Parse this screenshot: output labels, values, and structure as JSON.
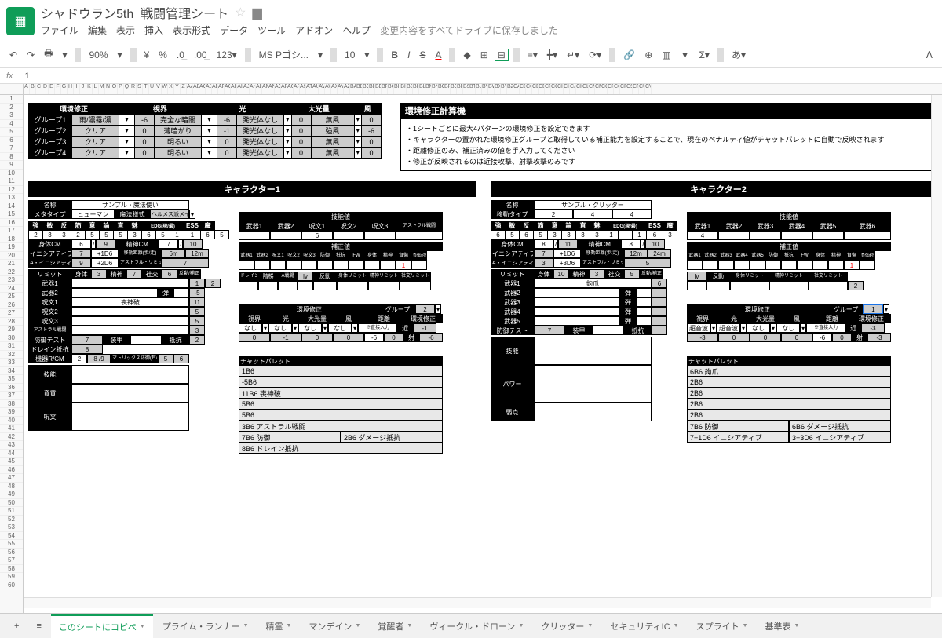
{
  "doc": {
    "title": "シャドウラン5th_戦闘管理シート",
    "save_msg": "変更内容をすべてドライブに保存しました"
  },
  "menu": [
    "ファイル",
    "編集",
    "表示",
    "挿入",
    "表示形式",
    "データ",
    "ツール",
    "アドオン",
    "ヘルプ"
  ],
  "toolbar": {
    "zoom": "90%",
    "currency": "¥",
    "font": "MS Pゴシ...",
    "size": "10"
  },
  "formula": "1",
  "env": {
    "title": "環境修正",
    "headers": [
      "視界",
      "光",
      "大光量",
      "風"
    ],
    "rows": [
      {
        "grp": "グループ1",
        "vis": "雨/濃霧/濃",
        "vis_v": "-6",
        "light": "完全な暗闇",
        "light_v": "-6",
        "glare": "発光体なし",
        "glare_v": "0",
        "wind": "無風",
        "wind_v": "0"
      },
      {
        "grp": "グループ2",
        "vis": "クリア",
        "vis_v": "0",
        "light": "薄暗がり",
        "light_v": "-1",
        "glare": "発光体なし",
        "glare_v": "0",
        "wind": "強風",
        "wind_v": "-6"
      },
      {
        "grp": "グループ3",
        "vis": "クリア",
        "vis_v": "0",
        "light": "明るい",
        "light_v": "0",
        "glare": "発光体なし",
        "glare_v": "0",
        "wind": "無風",
        "wind_v": "0"
      },
      {
        "grp": "グループ4",
        "vis": "クリア",
        "vis_v": "0",
        "light": "明るい",
        "light_v": "0",
        "glare": "発光体なし",
        "glare_v": "0",
        "wind": "無風",
        "wind_v": "0"
      }
    ]
  },
  "calc": {
    "title": "環境修正計算機",
    "lines": [
      "・1シートごとに最大4パターンの環境修正を設定できます",
      "・キャラクターの置かれた環境修正グループと取得している補正能力を設定することで、現在のペナルティ値がチャットパレットに自動で反映されます",
      "・距離修正のみ、補正済みの値を手入力してください",
      "・修正が反映されるのは近接攻撃、射撃攻撃のみです"
    ]
  },
  "char1": {
    "title": "キャラクター1",
    "name_lbl": "名称",
    "name": "サンプル・魔法使い",
    "meta_lbl": "メタタイプ",
    "meta": "ヒューマン",
    "magic_lbl": "魔法様式",
    "magic": "ヘルメス派メイジ",
    "attrs_hdr": [
      "強",
      "敏",
      "反",
      "筋",
      "意",
      "論",
      "直",
      "魅",
      "EDG(現/最)",
      "ESS",
      "魔"
    ],
    "attrs": [
      "2",
      "3",
      "3",
      "2",
      "5",
      "5",
      "5",
      "3",
      "6",
      "5",
      "1",
      "1",
      "6",
      "5"
    ],
    "body_cm_lbl": "身体CM",
    "body_cm": "6",
    "body_cm_max": "9",
    "mind_cm_lbl": "精神CM",
    "mind_cm": "7",
    "mind_cm_max": "10",
    "init_lbl": "イニシアティブ",
    "init": "7",
    "init_d": "+1D6",
    "move_lbl": "移動距離(歩/走)",
    "move": "6m",
    "run": "12m",
    "ainit_lbl": "A・イニシアティブ",
    "ainit": "9",
    "ainit_d": "+2D6",
    "alim_lbl": "アストラル・リミット",
    "alim": "7",
    "limit_lbl": "リミット",
    "phys_lbl": "身体",
    "phys": "3",
    "mind_lbl": "精神",
    "mind": "7",
    "soc_lbl": "社交",
    "soc": "6",
    "react_lbl": "反動/補正",
    "weapon1_lbl": "武器1",
    "weapon1_r": "1",
    "weapon1_r2": "2",
    "weapon2_lbl": "武器2",
    "weapon2_r": "-5",
    "bullet": "弾",
    "spell1_lbl": "呪文1",
    "spell1": "喪神破",
    "spell1_r": "11",
    "spell2_lbl": "呪文2",
    "spell2_r": "5",
    "spell3_lbl": "呪文3",
    "spell3_r": "5",
    "astral_lbl": "アストラル戦闘",
    "astral_r": "3",
    "def_lbl": "防御テスト",
    "def": "7",
    "armor_lbl": "装甲",
    "resist_lbl": "抵抗",
    "def_r": "2",
    "drain_lbl": "ドレイン抵抗",
    "drain": "8",
    "matrix_lbl": "機器R/CM",
    "matrix": "2",
    "matrix_cm": "8 /9",
    "mxdef_lbl": "マトリックス防御(耳/破)",
    "mxdef": "5",
    "mxdef2": "6",
    "skill_lbl": "技能",
    "quality_lbl": "資質",
    "spells_lbl": "呪文",
    "skill_hdr": "技能値",
    "skills": [
      "武器1",
      "武器2",
      "呪文1",
      "呪文2",
      "呪文3",
      "アストラル戦闘"
    ],
    "skill_val": "6",
    "mod_hdr": "補正値",
    "mod_sub": [
      "武器1",
      "武器2",
      "呪文1",
      "呪文2",
      "呪文3",
      "防御",
      "抵抗",
      "FW",
      "身体",
      "精神",
      "負傷",
      "負傷耐性"
    ],
    "mod_val": "1",
    "drain_sub": "ドレイン",
    "kaitei": "階梯",
    "asen": "A戦闘",
    "lv": "lv",
    "react_sub": "反動",
    "phys_lim_sub": "身体リミット",
    "mind_lim_sub": "精神リミット",
    "soc_lim_sub": "社交リミット",
    "env_mod_hdr": "環境修正",
    "group_lbl": "グループ",
    "group_val": "2",
    "env_hdrs": [
      "視界",
      "光",
      "大光量",
      "風",
      "距離",
      "環境修正"
    ],
    "env_row1": [
      "なし",
      "なし",
      "なし",
      "なし",
      "※直接入力",
      "近",
      "-1"
    ],
    "env_row2": [
      "0",
      "-1",
      "0",
      "0",
      "-6",
      "0",
      "射",
      "-6"
    ],
    "chat_lbl": "チャットパレット",
    "chat": [
      "1B6",
      "-5B6",
      "11B6 喪神破",
      "5B6",
      "5B6",
      "3B6 アストラル戦闘",
      "7B6 防御",
      "2B6 ダメージ抵抗",
      "8B6 ドレイン抵抗"
    ]
  },
  "char2": {
    "title": "キャラクター2",
    "name_lbl": "名称",
    "name": "サンプル・クリッター",
    "move_type_lbl": "移動タイプ",
    "move_type": [
      "2",
      "4",
      "4"
    ],
    "attrs_hdr": [
      "強",
      "敏",
      "反",
      "筋",
      "意",
      "論",
      "直",
      "魅",
      "EDG(現/最)",
      "ESS",
      "魔"
    ],
    "attrs": [
      "6",
      "5",
      "6",
      "5",
      "3",
      "3",
      "3",
      "3",
      "1",
      "1",
      "6",
      "3"
    ],
    "body_cm_lbl": "身体CM",
    "body_cm": "8",
    "body_cm_max": "11",
    "mind_cm_lbl": "精神CM",
    "mind_cm": "8",
    "mind_cm_max": "10",
    "init_lbl": "イニシアティブ",
    "init": "7",
    "init_d": "+1D6",
    "move_lbl": "移動距離(歩/走)",
    "move": "12m",
    "run": "24m",
    "ainit_lbl": "A・イニシアティブ",
    "ainit": "3",
    "ainit_d": "+3D6",
    "alim_lbl": "アストラル・リミット",
    "alim": "5",
    "limit_lbl": "リミット",
    "phys_lbl": "身体",
    "phys": "10",
    "mind_lbl": "精神",
    "mind": "3",
    "soc_lbl": "社交",
    "soc": "5",
    "react_lbl": "反動/補正",
    "weapon1_lbl": "武器1",
    "weapon1": "鉤爪",
    "weapon1_r": "6",
    "weapon2_lbl": "武器2",
    "weapon3_lbl": "武器3",
    "weapon4_lbl": "武器4",
    "weapon5_lbl": "武器5",
    "bullet": "弾",
    "def_lbl": "防御テスト",
    "def": "7",
    "armor_lbl": "装甲",
    "resist_lbl": "抵抗",
    "skill_lbl": "技能",
    "power_lbl": "パワー",
    "weak_lbl": "弱点",
    "skill_hdr": "技能値",
    "skills": [
      "武器1",
      "武器2",
      "武器3",
      "武器4",
      "武器5",
      "武器6"
    ],
    "skill_val": "4",
    "mod_hdr": "補正値",
    "mod_sub": [
      "武器1",
      "武器2",
      "武器3",
      "武器4",
      "武器5",
      "防御",
      "抵抗",
      "FW",
      "身体",
      "精神",
      "負傷",
      "負傷耐性"
    ],
    "mod_val": "1",
    "mod_red": "1",
    "lv": "lv",
    "react_sub": "反動",
    "phys_lim_sub": "身体リミット",
    "mind_lim_sub": "精神リミット",
    "soc_lim_sub": "社交リミット",
    "env_mod_hdr": "環境修正",
    "group_lbl": "グループ",
    "group_val": "1",
    "env_hdrs": [
      "視界",
      "光",
      "大光量",
      "風",
      "距離",
      "環境修正"
    ],
    "env_row1": [
      "超音波",
      "超音波",
      "なし",
      "なし",
      "※直接入力",
      "近",
      "-3"
    ],
    "env_row2": [
      "-3",
      "0",
      "0",
      "0",
      "-6",
      "0",
      "射",
      "-3"
    ],
    "env_r2": "2",
    "chat_lbl": "チャットパレット",
    "chat": [
      "6B6 鉤爪",
      "2B6",
      "2B6",
      "2B6",
      "2B6",
      "7B6 防御",
      "6B6 ダメージ抵抗",
      "7+1D6 イニシアティブ",
      "3+3D6 イニシアティブ"
    ]
  },
  "tabs": [
    "このシートにコピペ",
    "プライム・ランナー",
    "精霊",
    "マンデイン",
    "覚醒者",
    "ヴィークル・ドローン",
    "クリッター",
    "セキュリティIC",
    "スプライト",
    "基準表"
  ]
}
